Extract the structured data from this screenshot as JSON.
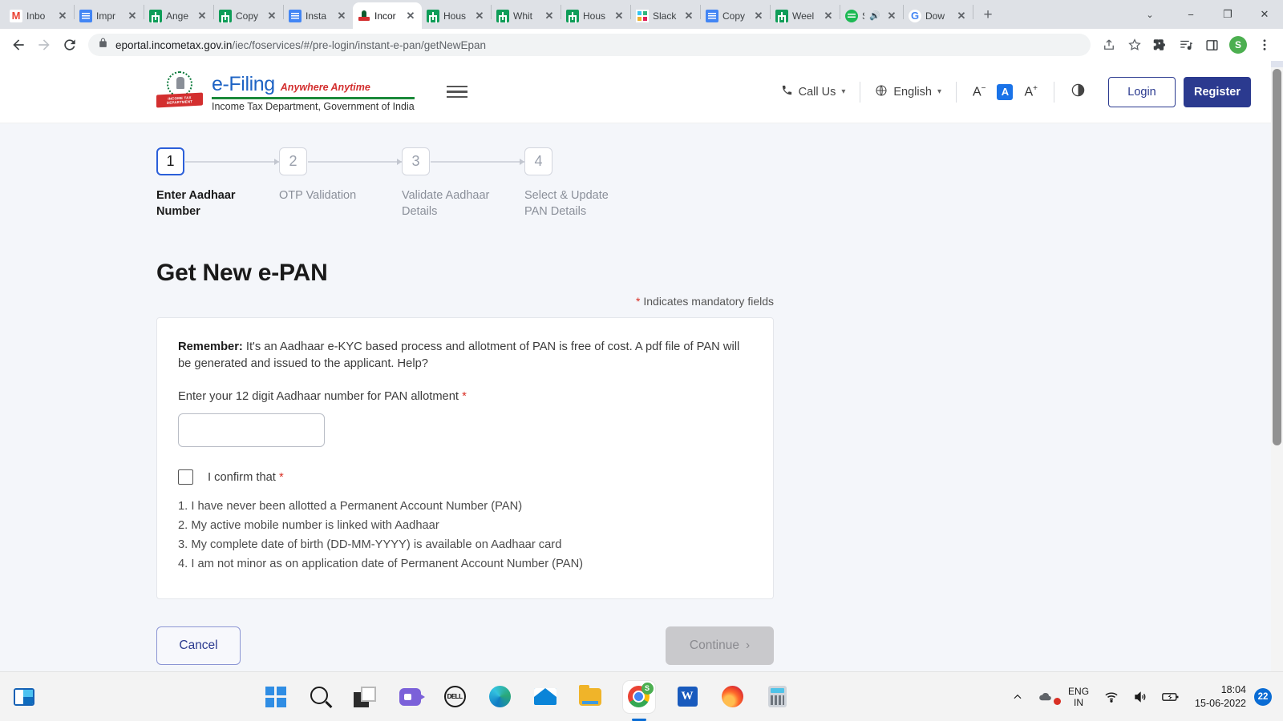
{
  "browser": {
    "tabs": [
      {
        "title": "Inbo",
        "favicon": "gmail-icon",
        "active": false
      },
      {
        "title": "Impr",
        "favicon": "google-docs-icon",
        "active": false
      },
      {
        "title": "Ange",
        "favicon": "google-sheets-icon",
        "active": false
      },
      {
        "title": "Copy",
        "favicon": "google-sheets-icon",
        "active": false
      },
      {
        "title": "Insta",
        "favicon": "google-docs-icon",
        "active": false
      },
      {
        "title": "Incor",
        "favicon": "income-tax-icon",
        "active": true
      },
      {
        "title": "Hous",
        "favicon": "google-sheets-icon",
        "active": false
      },
      {
        "title": "Whit",
        "favicon": "google-sheets-icon",
        "active": false
      },
      {
        "title": "Hous",
        "favicon": "google-sheets-icon",
        "active": false
      },
      {
        "title": "Slack",
        "favicon": "slack-icon",
        "active": false
      },
      {
        "title": "Copy",
        "favicon": "google-docs-icon",
        "active": false
      },
      {
        "title": "Weel",
        "favicon": "google-sheets-icon",
        "active": false
      },
      {
        "title": "S",
        "favicon": "spotify-icon",
        "active": false
      },
      {
        "title": "Dow",
        "favicon": "google-icon",
        "active": false
      }
    ],
    "new_tab_label": "+",
    "window_controls": {
      "caret": "⌄",
      "minimize": "−",
      "maximize": "❐",
      "close": "✕"
    },
    "url_host": "eportal.incometax.gov.in",
    "url_path": "/iec/foservices/#/pre-login/instant-e-pan/getNewEpan",
    "profile_initial": "S"
  },
  "site_header": {
    "logo": {
      "brand": "e-Filing",
      "tagline": "Anywhere Anytime",
      "subtitle": "Income Tax Department, Government of India",
      "ribbon": "INCOME TAX DEPARTMENT"
    },
    "call_us": "Call Us",
    "language": "English",
    "font_decrease": "A",
    "font_normal": "A",
    "font_increase": "A",
    "login": "Login",
    "register": "Register"
  },
  "stepper": {
    "steps": [
      {
        "number": "1",
        "label": "Enter Aadhaar Number",
        "active": true
      },
      {
        "number": "2",
        "label": "OTP Validation",
        "active": false
      },
      {
        "number": "3",
        "label": "Validate Aadhaar Details",
        "active": false
      },
      {
        "number": "4",
        "label": "Select & Update PAN Details",
        "active": false
      }
    ]
  },
  "main": {
    "page_title": "Get New e-PAN",
    "mandatory_note": "Indicates mandatory fields",
    "remember_label": "Remember:",
    "remember_text": " It's an Aadhaar e-KYC based process and allotment of PAN is free of cost. A pdf file of PAN will be generated and issued to the applicant. Help?",
    "aadhaar_field_label": "Enter your 12 digit Aadhaar number for PAN allotment",
    "aadhaar_value": "",
    "aadhaar_placeholder": "",
    "confirm_label": "I confirm that",
    "confirm_items": [
      "1. I have never been allotted a Permanent Account Number (PAN)",
      "2. My active mobile number is linked with Aadhaar",
      "3. My complete date of birth (DD-MM-YYYY) is available on Aadhaar card",
      "4. I am not minor as on application date of Permanent Account Number (PAN)"
    ],
    "cancel_label": "Cancel",
    "continue_label": "Continue",
    "continue_chevron": "›",
    "continue_disabled": true
  },
  "taskbar": {
    "apps": [
      {
        "name": "start-button"
      },
      {
        "name": "search-button"
      },
      {
        "name": "task-view-button"
      },
      {
        "name": "teams-chat-button"
      },
      {
        "name": "dell-button",
        "label": "DELL"
      },
      {
        "name": "edge-button"
      },
      {
        "name": "mail-button"
      },
      {
        "name": "file-explorer-button"
      },
      {
        "name": "chrome-button",
        "badge": "S",
        "active": true
      },
      {
        "name": "word-button",
        "label": "W"
      },
      {
        "name": "firefox-button"
      },
      {
        "name": "calculator-button"
      }
    ],
    "tray": {
      "language_line1": "ENG",
      "language_line2": "IN",
      "time": "18:04",
      "date": "15-06-2022",
      "notification_count": "22"
    }
  },
  "colors": {
    "brand_blue": "#2b3a8f",
    "accent_blue": "#2b5fd9",
    "required_red": "#d93025",
    "page_bg": "#f4f6fa"
  }
}
